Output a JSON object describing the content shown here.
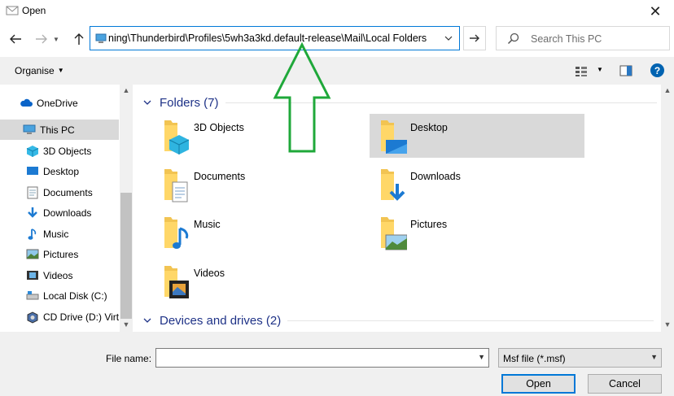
{
  "window": {
    "title": "Open",
    "close_icon": "close-icon"
  },
  "nav": {
    "back_icon": "back-arrow-icon",
    "forward_icon": "forward-arrow-icon",
    "up_icon": "up-arrow-icon",
    "address": "ning\\Thunderbird\\Profiles\\5wh3a3kd.default-release\\Mail\\Local Folders",
    "refresh_icon": "go-arrow-icon",
    "search_placeholder": "Search This PC"
  },
  "toolbar": {
    "organise_label": "Organise",
    "accent_color": "#0063b1"
  },
  "sidebar": {
    "items": [
      {
        "label": "OneDrive",
        "icon": "cloud-icon"
      },
      {
        "label": "This PC",
        "icon": "computer-icon",
        "selected": true
      },
      {
        "label": "3D Objects",
        "icon": "cube-icon"
      },
      {
        "label": "Desktop",
        "icon": "desktop-icon"
      },
      {
        "label": "Documents",
        "icon": "document-icon"
      },
      {
        "label": "Downloads",
        "icon": "download-icon"
      },
      {
        "label": "Music",
        "icon": "music-note-icon"
      },
      {
        "label": "Pictures",
        "icon": "picture-icon"
      },
      {
        "label": "Videos",
        "icon": "film-icon"
      },
      {
        "label": "Local Disk (C:)",
        "icon": "drive-icon"
      },
      {
        "label": "CD Drive (D:) Virt",
        "icon": "cd-drive-icon"
      }
    ]
  },
  "main": {
    "folders_header": "Folders (7)",
    "folders": [
      {
        "label": "3D Objects",
        "icon": "folder-3d-objects-icon"
      },
      {
        "label": "Desktop",
        "icon": "folder-desktop-icon",
        "selected": true
      },
      {
        "label": "Documents",
        "icon": "folder-documents-icon"
      },
      {
        "label": "Downloads",
        "icon": "folder-downloads-icon"
      },
      {
        "label": "Music",
        "icon": "folder-music-icon"
      },
      {
        "label": "Pictures",
        "icon": "folder-pictures-icon"
      },
      {
        "label": "Videos",
        "icon": "folder-videos-icon"
      }
    ],
    "devices_header": "Devices and drives (2)"
  },
  "footer": {
    "file_name_label": "File name:",
    "file_name_value": "",
    "file_type_value": "Msf file (*.msf)",
    "open_label": "Open",
    "cancel_label": "Cancel"
  },
  "annotation": {
    "color": "#1fa83a",
    "shape": "up-arrow"
  }
}
